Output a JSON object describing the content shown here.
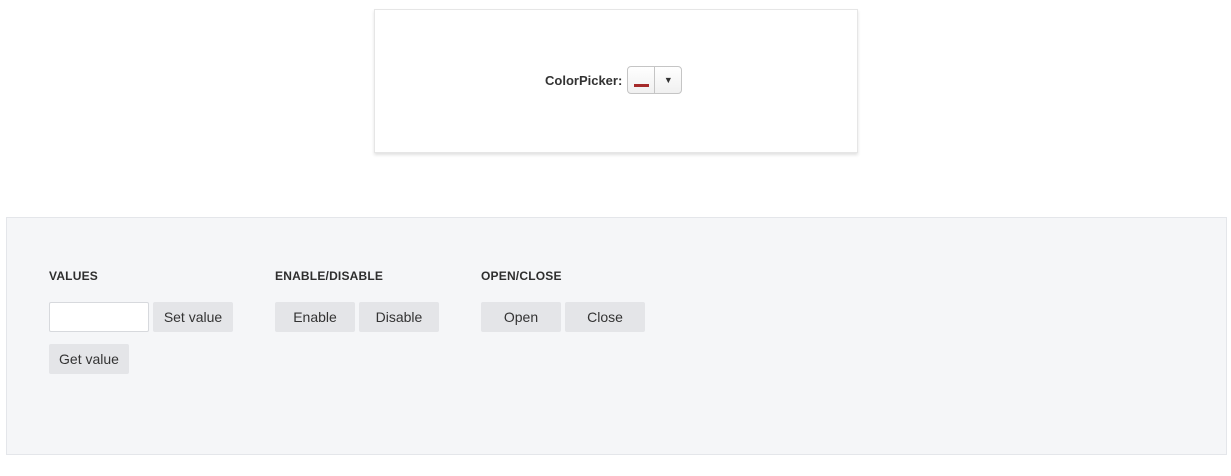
{
  "demo": {
    "label": "ColorPicker:",
    "selected_color": "#a52a2a",
    "dropdown_arrow": "▼"
  },
  "panel": {
    "values": {
      "title": "VALUES",
      "input_value": "",
      "set_value_label": "Set value",
      "get_value_label": "Get value"
    },
    "enable_disable": {
      "title": "ENABLE/DISABLE",
      "enable_label": "Enable",
      "disable_label": "Disable"
    },
    "open_close": {
      "title": "OPEN/CLOSE",
      "open_label": "Open",
      "close_label": "Close"
    }
  },
  "colors": {
    "panel_background": "#f5f6f8",
    "button_background": "#e4e5e8"
  }
}
